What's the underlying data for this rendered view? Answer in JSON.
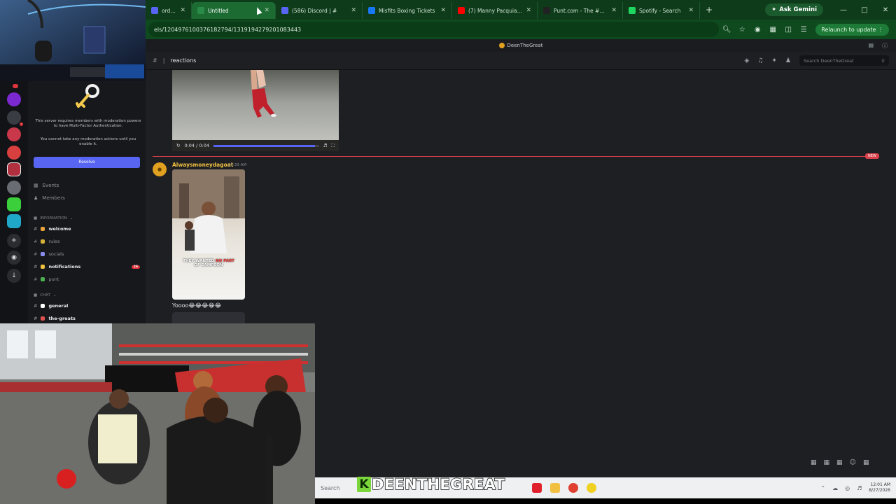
{
  "browser": {
    "tabs": [
      {
        "title": "ord | #",
        "fav": "#5865f2",
        "active": false
      },
      {
        "title": "Untitled",
        "fav": "#2a8a48",
        "active": true
      },
      {
        "title": "(586) Discord | #",
        "fav": "#5865f2",
        "active": false
      },
      {
        "title": "Misfits Boxing Tickets",
        "fav": "#1877f2",
        "active": false
      },
      {
        "title": "(7) Manny Pacquiao vs",
        "fav": "#ff0000",
        "active": false
      },
      {
        "title": "Punt.com - The #1 Fre",
        "fav": "#222222",
        "active": false
      },
      {
        "title": "Spotify - Search",
        "fav": "#1ed760",
        "active": false
      }
    ],
    "new_tab_icon": "plus-icon",
    "gemini_label": "Ask Gemini",
    "url": "els/1204976100376182794/1319194279201083443",
    "relaunch_label": "Relaunch to update"
  },
  "discord": {
    "server_name": "DeenTheGreat",
    "channel_name": "reactions",
    "search_placeholder": "Search DeenTheGreat",
    "mfa": {
      "text1": "This server requires members with moderation powers to have Multi-Factor Authentication.",
      "text2": "You cannot take any moderation actions until you enable it.",
      "resolve_label": "Resolve"
    },
    "nav": [
      {
        "label": "Events",
        "icon": "calendar-icon"
      },
      {
        "label": "Members",
        "icon": "members-icon"
      }
    ],
    "categories": {
      "information": "INFORMATION",
      "chat": "CHAT"
    },
    "channels": [
      {
        "label": "welcome",
        "bright": true,
        "emoji": "#e8a23a"
      },
      {
        "label": "rules",
        "bright": false,
        "emoji": "#d4b23a"
      },
      {
        "label": "socials",
        "bright": false,
        "emoji": "#8a8df0"
      },
      {
        "label": "notifications",
        "bright": true,
        "emoji": "#f0c040",
        "ping": "26"
      },
      {
        "label": "punt",
        "bright": false,
        "emoji": "#4caf50"
      },
      {
        "label": "general",
        "bright": true,
        "emoji": "#ffffff"
      },
      {
        "label": "the-greats",
        "bright": true,
        "emoji": "#e05050"
      }
    ],
    "video": {
      "time": "0:04 / 0:04",
      "progress": 0.96
    },
    "new_badge": "NEW",
    "message": {
      "author": "Alwaysmoneydagoat",
      "time": "11:33 AM",
      "caption_white": "THEY WANTED",
      "caption_red": "NO PART",
      "caption_white2": "OF SAMPSON",
      "text": "Yoooo😂😂😂😂😂"
    }
  },
  "taskbar": {
    "search_label": "Search",
    "time": "12:01 AM",
    "date": "8/27/2026"
  },
  "overlay": {
    "k": "K",
    "name": "DEENTHEGREAT"
  }
}
